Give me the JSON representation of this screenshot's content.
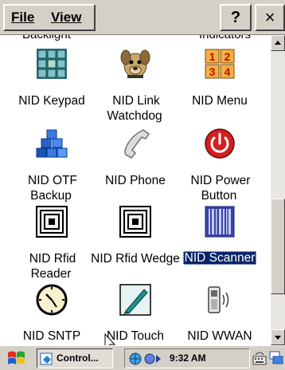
{
  "menubar": {
    "file_label": "File",
    "view_label": "View",
    "help_label": "?",
    "close_label": "×"
  },
  "partial_labels": {
    "left": "Backlight",
    "right": "Indicators"
  },
  "items": [
    {
      "label": "NID Keypad",
      "icon": "keypad-icon"
    },
    {
      "label": "NID Link Watchdog",
      "icon": "watchdog-icon"
    },
    {
      "label": "NID Menu",
      "icon": "menu-grid-icon"
    },
    {
      "label": "NID OTF Backup",
      "icon": "backup-cubes-icon"
    },
    {
      "label": "NID Phone",
      "icon": "phone-handset-icon"
    },
    {
      "label": "NID Power Button",
      "icon": "power-button-icon"
    },
    {
      "label": "NID Rfid Reader",
      "icon": "rfid-reader-icon"
    },
    {
      "label": "NID Rfid Wedge",
      "icon": "rfid-wedge-icon"
    },
    {
      "label": "NID Scanner",
      "icon": "barcode-scanner-icon",
      "selected": true
    },
    {
      "label": "NID SNTP",
      "icon": "clock-icon"
    },
    {
      "label": "NID Touch",
      "icon": "stylus-icon"
    },
    {
      "label": "NID WWAN",
      "icon": "wwan-device-icon"
    }
  ],
  "menu_digits": [
    "1",
    "2",
    "3",
    "4"
  ],
  "taskbar": {
    "task_label": "Control...",
    "time": "9:32 AM"
  },
  "colors": {
    "selection": "#0a246a",
    "chrome": "#d4d0c8"
  }
}
